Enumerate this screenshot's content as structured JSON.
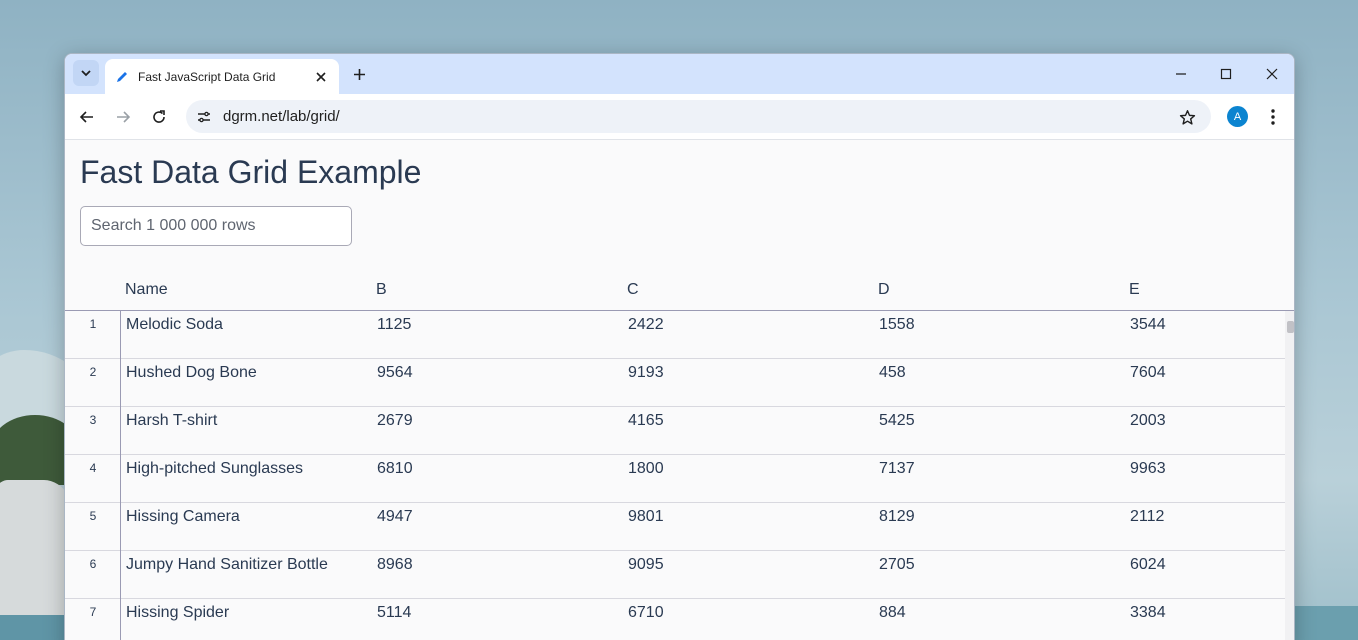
{
  "browser": {
    "tab_title": "Fast JavaScript Data Grid",
    "url": "dgrm.net/lab/grid/",
    "profile_initial": "A",
    "accent_color": "#0b84d0"
  },
  "page": {
    "title": "Fast Data Grid Example",
    "search_placeholder": "Search 1 000 000 rows"
  },
  "grid": {
    "columns": [
      "Name",
      "B",
      "C",
      "D",
      "E"
    ],
    "rows": [
      {
        "num": "1",
        "name": "Melodic Soda",
        "b": "1125",
        "c": "2422",
        "d": "1558",
        "e": "3544"
      },
      {
        "num": "2",
        "name": "Hushed Dog Bone",
        "b": "9564",
        "c": "9193",
        "d": "458",
        "e": "7604"
      },
      {
        "num": "3",
        "name": "Harsh T-shirt",
        "b": "2679",
        "c": "4165",
        "d": "5425",
        "e": "2003"
      },
      {
        "num": "4",
        "name": "High-pitched Sunglasses",
        "b": "6810",
        "c": "1800",
        "d": "7137",
        "e": "9963"
      },
      {
        "num": "5",
        "name": "Hissing Camera",
        "b": "4947",
        "c": "9801",
        "d": "8129",
        "e": "2112"
      },
      {
        "num": "6",
        "name": "Jumpy Hand Sanitizer Bottle",
        "b": "8968",
        "c": "9095",
        "d": "2705",
        "e": "6024"
      },
      {
        "num": "7",
        "name": "Hissing Spider",
        "b": "5114",
        "c": "6710",
        "d": "884",
        "e": "3384"
      }
    ]
  }
}
